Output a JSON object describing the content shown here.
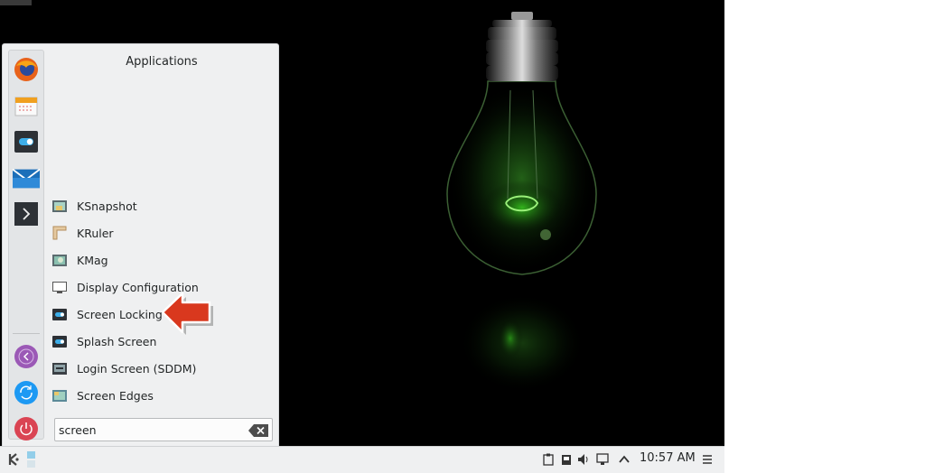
{
  "menu": {
    "title": "Applications",
    "favorites": [
      {
        "name": "firefox-icon"
      },
      {
        "name": "calendar-icon"
      },
      {
        "name": "system-settings-icon"
      },
      {
        "name": "mail-icon"
      },
      {
        "name": "terminal-icon"
      }
    ],
    "session_buttons": [
      {
        "name": "leave-icon"
      },
      {
        "name": "switch-user-icon"
      },
      {
        "name": "power-icon"
      }
    ],
    "items": [
      {
        "label": "KSnapshot",
        "icon": "ksnapshot-icon"
      },
      {
        "label": "KRuler",
        "icon": "kruler-icon"
      },
      {
        "label": "KMag",
        "icon": "kmag-icon"
      },
      {
        "label": "Display Configuration",
        "icon": "display-icon"
      },
      {
        "label": "Screen Locking",
        "icon": "screen-locking-icon"
      },
      {
        "label": "Splash Screen",
        "icon": "splash-screen-icon"
      },
      {
        "label": "Login Screen (SDDM)",
        "icon": "login-screen-icon"
      },
      {
        "label": "Screen Edges",
        "icon": "screen-edges-icon"
      }
    ],
    "search": {
      "value": "screen",
      "placeholder": ""
    }
  },
  "taskbar": {
    "time": "10:57 AM",
    "tray_icons": [
      "clipboard-icon",
      "battery-icon",
      "volume-icon",
      "network-icon",
      "expand-tray-icon",
      "menu-icon"
    ]
  },
  "colors": {
    "accent": "#3daee9",
    "desktop_bg": "#000000",
    "menu_bg": "#eff0f1",
    "arrow": "#d9381e"
  }
}
